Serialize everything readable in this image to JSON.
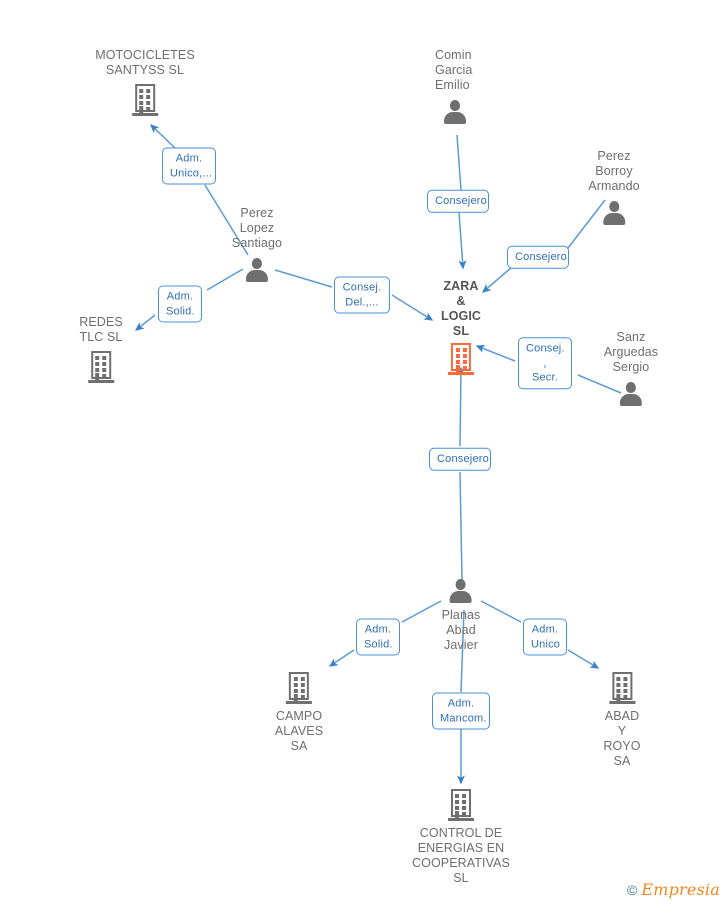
{
  "graph": {
    "center_company": "ZARA & LOGIC SL",
    "accent_color": "#fa6a3b",
    "node_color": "#6f6f6f",
    "edge_color": "#4a90d9",
    "label_text_color": "#2d6fb5"
  },
  "nodes": {
    "motocicletes": {
      "label": "MOTOCICLETES\nSANTYSS SL",
      "type": "company-icon"
    },
    "perez_lopez": {
      "label": "Perez Lopez\nSantiago",
      "type": "person-icon"
    },
    "redes_tlc": {
      "label": "REDES TLC SL",
      "type": "company-icon"
    },
    "comin_garcia": {
      "label": "Comin\nGarcia\nEmilio",
      "type": "person-icon"
    },
    "perez_borroy": {
      "label": "Perez Borroy\nArmando",
      "type": "person-icon"
    },
    "zara_logic": {
      "label": "ZARA &\nLOGIC SL",
      "type": "company-icon-focus"
    },
    "sanz_arguedas": {
      "label": "Sanz\nArguedas\nSergio",
      "type": "person-icon"
    },
    "planas_abad": {
      "label": "Planas\nAbad Javier",
      "type": "person-icon"
    },
    "campo_alaves": {
      "label": "CAMPO\nALAVES SA",
      "type": "company-icon"
    },
    "abad_royo": {
      "label": "ABAD Y\nROYO SA",
      "type": "company-icon"
    },
    "control_energias": {
      "label": "CONTROL DE\nENERGIAS EN\nCOOPERATIVAS SL",
      "type": "company-icon"
    }
  },
  "relations": [
    {
      "id": "rel-adm-unico-moto",
      "label": "Adm.\nUnico,...",
      "from": "perez_lopez",
      "to": "motocicletes"
    },
    {
      "id": "rel-adm-solid-redes",
      "label": "Adm.\nSolid.",
      "from": "perez_lopez",
      "to": "redes_tlc"
    },
    {
      "id": "rel-consej-del-zara",
      "label": "Consej.\nDel.,...",
      "from": "perez_lopez",
      "to": "zara_logic"
    },
    {
      "id": "rel-consejero-comin",
      "label": "Consejero",
      "from": "comin_garcia",
      "to": "zara_logic"
    },
    {
      "id": "rel-consejero-borroy",
      "label": "Consejero",
      "from": "perez_borroy",
      "to": "zara_logic"
    },
    {
      "id": "rel-consej-secr-sanz",
      "label": "Consej. ,\nSecr.",
      "from": "sanz_arguedas",
      "to": "zara_logic"
    },
    {
      "id": "rel-consejero-planas",
      "label": "Consejero",
      "from": "planas_abad",
      "to": "zara_logic"
    },
    {
      "id": "rel-adm-solid-campo",
      "label": "Adm.\nSolid.",
      "from": "planas_abad",
      "to": "campo_alaves"
    },
    {
      "id": "rel-adm-unico-abad",
      "label": "Adm.\nUnico",
      "from": "planas_abad",
      "to": "abad_royo"
    },
    {
      "id": "rel-adm-mancom-control",
      "label": "Adm.\nMancom.",
      "from": "planas_abad",
      "to": "control_energias"
    }
  ],
  "watermark": {
    "copyright": "©",
    "name": "Empresia"
  }
}
